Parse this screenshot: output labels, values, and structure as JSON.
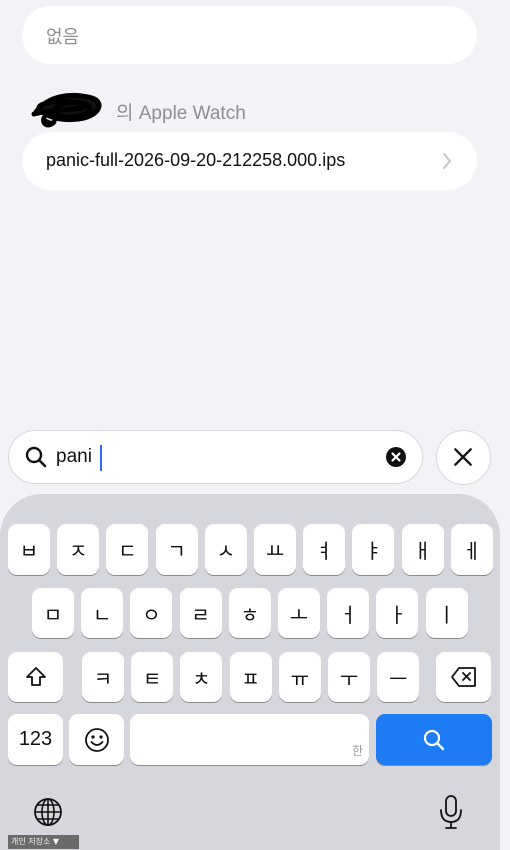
{
  "section_empty": {
    "text": "없음"
  },
  "section_watch": {
    "header": "의 Apple Watch"
  },
  "file_item": {
    "name": "panic-full-2026-09-20-212258.000.ips"
  },
  "search": {
    "query": "pani"
  },
  "keyboard": {
    "row1": [
      "ㅂ",
      "ㅈ",
      "ㄷ",
      "ㄱ",
      "ㅅ",
      "ㅛ",
      "ㅕ",
      "ㅑ",
      "ㅐ",
      "ㅔ"
    ],
    "row2": [
      "ㅁ",
      "ㄴ",
      "ㅇ",
      "ㄹ",
      "ㅎ",
      "ㅗ",
      "ㅓ",
      "ㅏ",
      "ㅣ"
    ],
    "row3": [
      "ㅋ",
      "ㅌ",
      "ㅊ",
      "ㅍ",
      "ㅠ",
      "ㅜ",
      "ㅡ"
    ],
    "numbers_label": "123",
    "space_hint": "한"
  },
  "watermark": {
    "text": "개인 저장소 ▼"
  },
  "colors": {
    "accent": "#1d7bf3",
    "background": "#f2f2f7",
    "keyboard": "#d6d7dc"
  },
  "icons": [
    "search-icon",
    "clear-icon",
    "close-icon",
    "shift-icon",
    "delete-icon",
    "emoji-icon",
    "globe-icon",
    "mic-icon",
    "chevron-right-icon"
  ]
}
